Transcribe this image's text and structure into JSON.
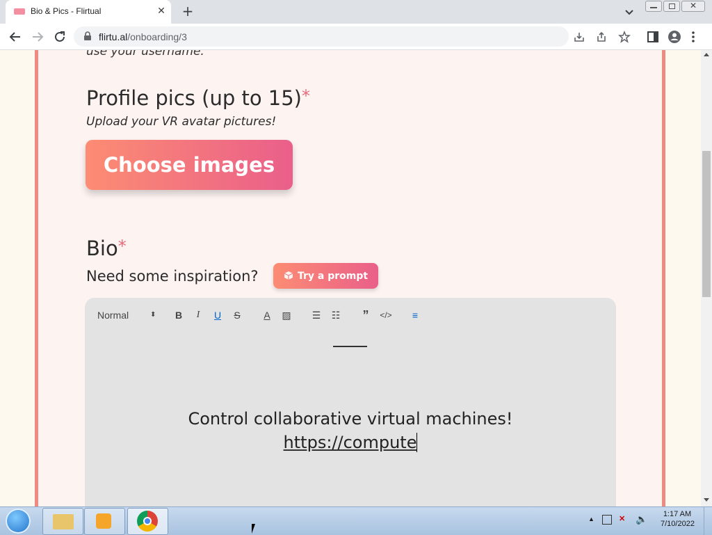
{
  "browser": {
    "tab_title": "Bio & Pics - Flirtual",
    "url_host": "flirtu.al",
    "url_path": "/onboarding/3"
  },
  "page": {
    "partial_text": "use your username.",
    "pics_title": "Profile pics (up to 15)",
    "required_mark": "*",
    "pics_subtitle": "Upload your VR avatar pictures!",
    "choose_images_label": "Choose images",
    "bio_title": "Bio",
    "inspiration_label": "Need some inspiration?",
    "prompt_button_label": "Try a prompt",
    "editor": {
      "format_select": "Normal",
      "line1": "Control collaborative virtual machines!",
      "line2": "https://compute"
    }
  },
  "taskbar": {
    "time": "1:17 AM",
    "date": "7/10/2022"
  },
  "colors": {
    "accent_start": "#fc8c73",
    "accent_end": "#ea5f8a",
    "card_border": "#ef8a80"
  }
}
